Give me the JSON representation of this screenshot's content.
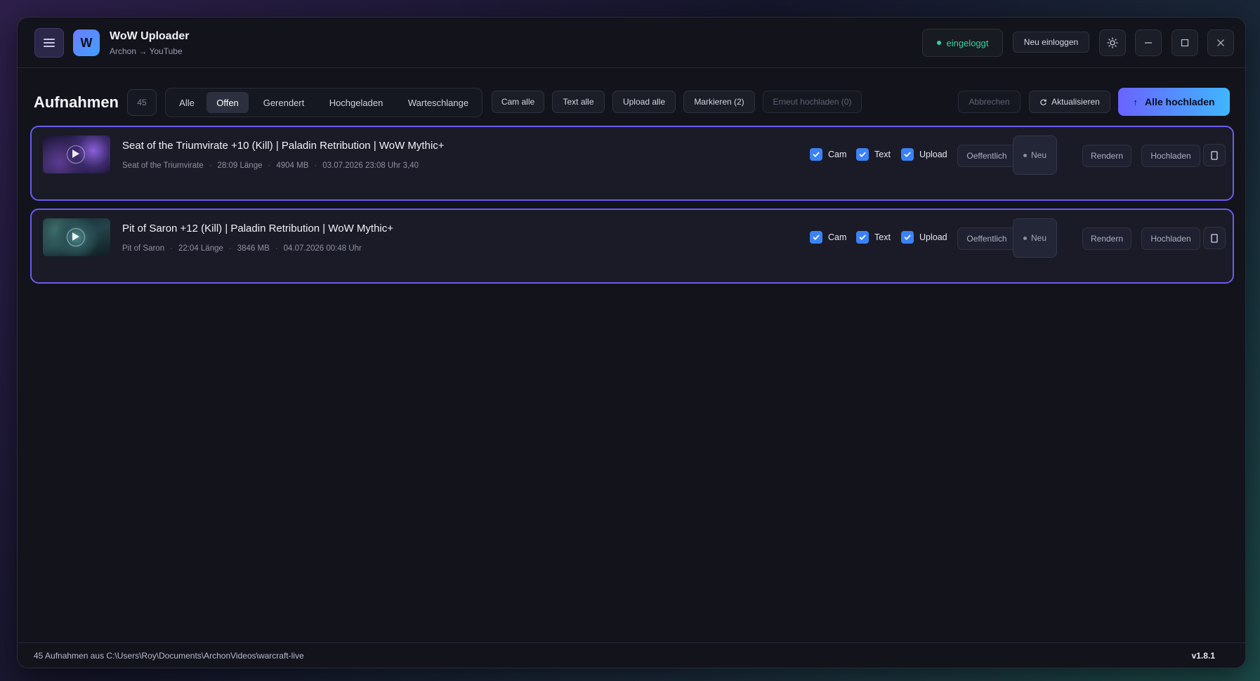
{
  "app": {
    "title": "WoW Uploader",
    "subtitle": "Archon → YouTube",
    "logo_letter": "W",
    "accent_gradient": [
      "#6a63ff",
      "#3fb6ff"
    ],
    "border_accent": "#6b5cf0"
  },
  "titlebar": {
    "status": "eingeloggt",
    "status_color": "#35d39a",
    "relogin_label": "Neu einloggen",
    "theme_icon": "sun-icon",
    "minimize_icon": "minimize-icon",
    "maximize_icon": "maximize-icon",
    "close_icon": "close-icon"
  },
  "toolbar": {
    "title": "Aufnahmen",
    "count": "45",
    "tabs": [
      {
        "label": "Alle"
      },
      {
        "label": "Offen",
        "active": true
      },
      {
        "label": "Gerendert"
      },
      {
        "label": "Hochgeladen"
      },
      {
        "label": "Warteschlange"
      }
    ],
    "cam_all": "Cam alle",
    "text_all": "Text alle",
    "upload_all": "Upload alle",
    "mark": "Markieren (2)",
    "reupload": "Erneut hochladen (0)",
    "cancel": "Abbrechen",
    "refresh": "Aktualisieren",
    "upload_everything": "Alle hochladen"
  },
  "recordings": [
    {
      "title": "Seat of the Triumvirate +10 (Kill) | Paladin Retribution | WoW Mythic+",
      "dungeon": "Seat of the Triumvirate",
      "length": "28:09 Länge",
      "size": "4904 MB",
      "date": "03.07.2026 23:08 Uhr 3,40",
      "cam": "Cam",
      "text": "Text",
      "upload": "Upload",
      "visibility": "Oeffentlich",
      "state": "Neu",
      "render": "Rendern",
      "publish": "Hochladen"
    },
    {
      "title": "Pit of Saron +12 (Kill) | Paladin Retribution | WoW Mythic+",
      "dungeon": "Pit of Saron",
      "length": "22:04 Länge",
      "size": "3846 MB",
      "date": "04.07.2026 00:48 Uhr",
      "cam": "Cam",
      "text": "Text",
      "upload": "Upload",
      "visibility": "Oeffentlich",
      "state": "Neu",
      "render": "Rendern",
      "publish": "Hochladen"
    }
  ],
  "footer": {
    "path_info": "45 Aufnahmen aus C:\\Users\\Roy\\Documents\\ArchonVideos\\warcraft-live",
    "version": "v1.8.1"
  }
}
